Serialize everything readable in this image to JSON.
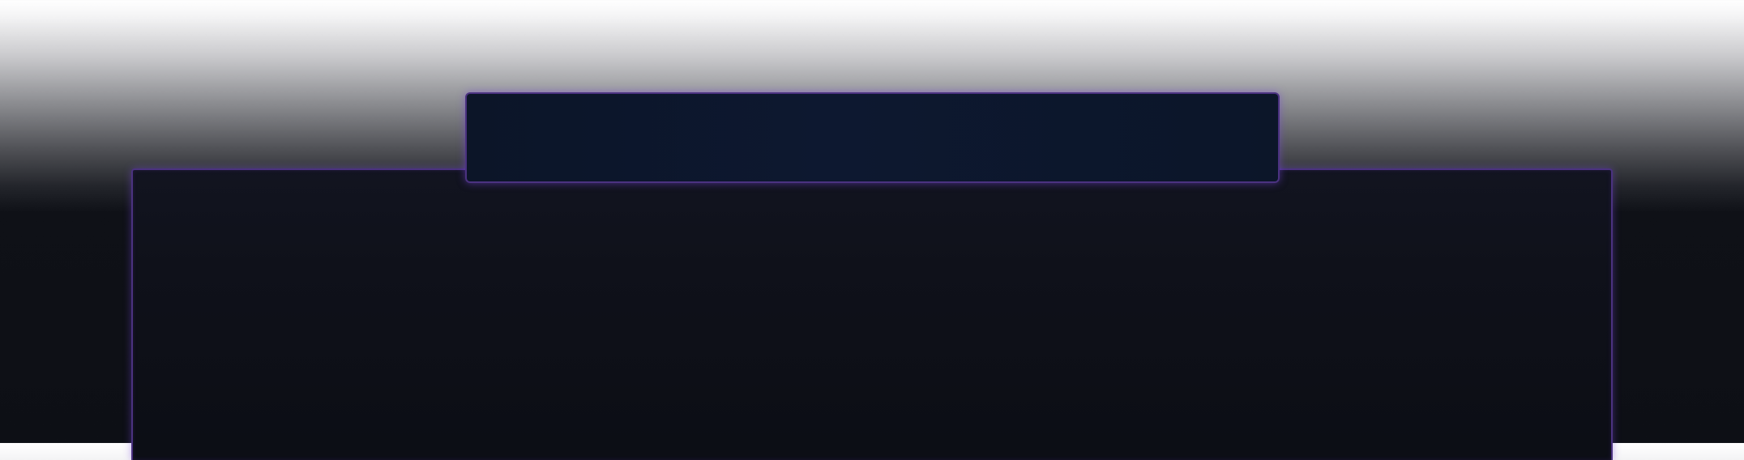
{
  "theme": {
    "background_top": "#ffffff",
    "background_bottom": "#0d0f15",
    "panel_color": "#0f111a",
    "header_bar_color": "#0d1830",
    "accent_glow": "#4b3280"
  },
  "header_bar": {
    "text": ""
  },
  "main_panel": {
    "text": ""
  }
}
